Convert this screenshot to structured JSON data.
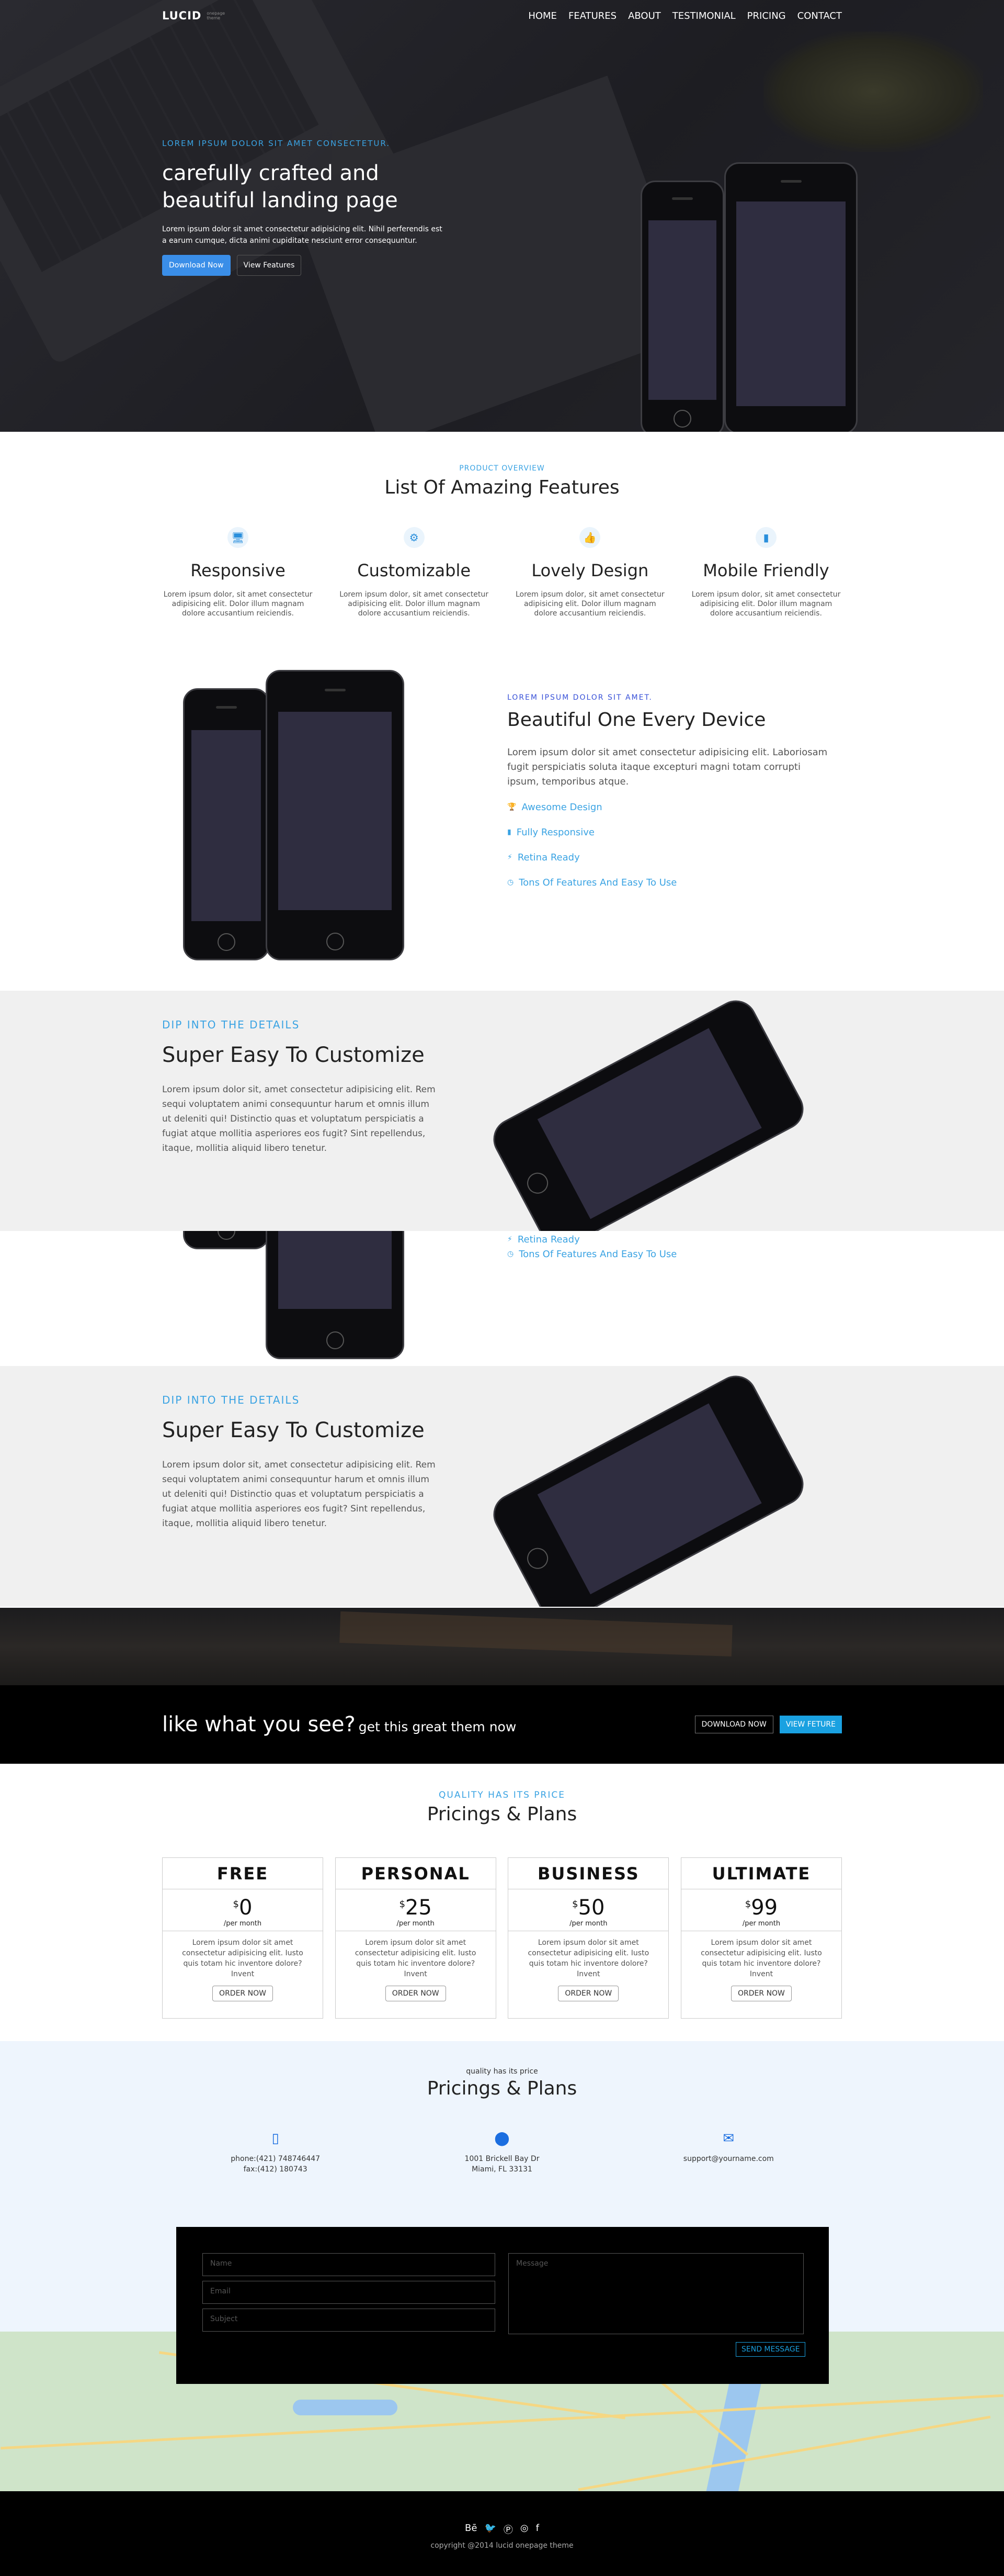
{
  "nav": {
    "brand": "LUCID",
    "tagline": "onepage theme",
    "items": [
      "HOME",
      "FEATURES",
      "ABOUT",
      "TESTIMONIAL",
      "PRICING",
      "CONTACT"
    ]
  },
  "hero": {
    "kicker": "LOREM IPSUM DOLOR SIT AMET CONSECTETUR.",
    "title_line1": "carefully crafted and",
    "title_line2": "beautiful landing page",
    "desc": "Lorem ipsum dolor sit amet consectetur adipisicing elit. Nihil perferendis est a earum cumque, dicta animi cupiditate nesciunt error consequuntur.",
    "btn_primary": "Download Now",
    "btn_secondary": "View Features"
  },
  "overview": {
    "kicker": "PRODUCT OVERVIEW",
    "title": "List Of Amazing Features",
    "features": [
      {
        "icon": "desktop-icon",
        "title": "Responsive",
        "desc": "Lorem ipsum dolor, sit amet consectetur adipisicing elit. Dolor illum magnam dolore accusantium reiciendis."
      },
      {
        "icon": "gear-icon",
        "title": "Customizable",
        "desc": "Lorem ipsum dolor, sit amet consectetur adipisicing elit. Dolor illum magnam dolore accusantium reiciendis."
      },
      {
        "icon": "thumbs-up-icon",
        "title": "Lovely Design",
        "desc": "Lorem ipsum dolor, sit amet consectetur adipisicing elit. Dolor illum magnam dolore accusantium reiciendis."
      },
      {
        "icon": "mobile-icon",
        "title": "Mobile Friendly",
        "desc": "Lorem ipsum dolor, sit amet consectetur adipisicing elit. Dolor illum magnam dolore accusantium reiciendis."
      }
    ]
  },
  "device": {
    "kicker": "LOREM IPSUM DOLOR SIT AMET.",
    "title": "Beautiful One Every Device",
    "desc": "Lorem ipsum dolor sit amet consectetur adipisicing elit. Laboriosam fugit perspiciatis soluta itaque excepturi magni totam corrupti ipsum, temporibus atque.",
    "list": [
      {
        "icon": "trophy-icon",
        "label": "Awesome Design"
      },
      {
        "icon": "mobile-icon",
        "label": "Fully Responsive"
      },
      {
        "icon": "bolt-icon",
        "label": "Retina Ready"
      },
      {
        "icon": "clock-icon",
        "label": "Tons Of Features And Easy To Use"
      }
    ]
  },
  "custom": {
    "kicker": "DIP INTO THE DETAILS",
    "title": "Super Easy To Customize",
    "desc": "Lorem ipsum dolor sit, amet consectetur adipisicing elit. Rem sequi voluptatem animi consequuntur harum et omnis illum ut deleniti qui! Distinctio quas et voluptatum perspiciatis a fugiat atque mollitia asperiores eos fugit? Sint repellendus, itaque, mollitia aliquid libero tenetur."
  },
  "cta": {
    "title": "like what you see?",
    "sub": "get this great them now",
    "btn1": "DOWNLOAD NOW",
    "btn2": "VIEW FETURE"
  },
  "pricing": {
    "kicker": "QUALITY HAS ITS PRICE",
    "title": "Pricings & Plans",
    "plans": [
      {
        "name": "FREE",
        "currency": "$",
        "price": "0",
        "per": "/per month",
        "desc": "Lorem ipsum dolor sit amet consectetur adipisicing elit. Iusto quis totam hic inventore dolore? Invent",
        "btn": "ORDER NOW"
      },
      {
        "name": "PERSONAL",
        "currency": "$",
        "price": "25",
        "per": "/per month",
        "desc": "Lorem ipsum dolor sit amet consectetur adipisicing elit. Iusto quis totam hic inventore dolore? Invent",
        "btn": "ORDER NOW"
      },
      {
        "name": "BUSINESS",
        "currency": "$",
        "price": "50",
        "per": "/per month",
        "desc": "Lorem ipsum dolor sit amet consectetur adipisicing elit. Iusto quis totam hic inventore dolore? Invent",
        "btn": "ORDER NOW"
      },
      {
        "name": "ULTIMATE",
        "currency": "$",
        "price": "99",
        "per": "/per month",
        "desc": "Lorem ipsum dolor sit amet consectetur adipisicing elit. Iusto quis totam hic inventore dolore? Invent",
        "btn": "ORDER NOW"
      }
    ]
  },
  "contact": {
    "sub": "quality has its price",
    "title": "Pricings & Plans",
    "items": [
      {
        "icon": "phone-icon",
        "line1": "phone:(421) 748746447",
        "line2": "fax:(412) 180743"
      },
      {
        "icon": "map-marker-icon",
        "line1": "1001 Brickell Bay Dr",
        "line2": "Miami, FL 33131"
      },
      {
        "icon": "envelope-icon",
        "line1": "support@yourname.com",
        "line2": ""
      }
    ],
    "form": {
      "name": "Name",
      "email": "Email",
      "subject": "Subject",
      "message": "Message",
      "send": "SEND MESSAGE"
    }
  },
  "footer": {
    "social": [
      "behance-icon",
      "twitter-icon",
      "pinterest-icon",
      "instagram-icon",
      "facebook-icon"
    ],
    "copyright": "copyright @2014 lucid onepage theme"
  }
}
